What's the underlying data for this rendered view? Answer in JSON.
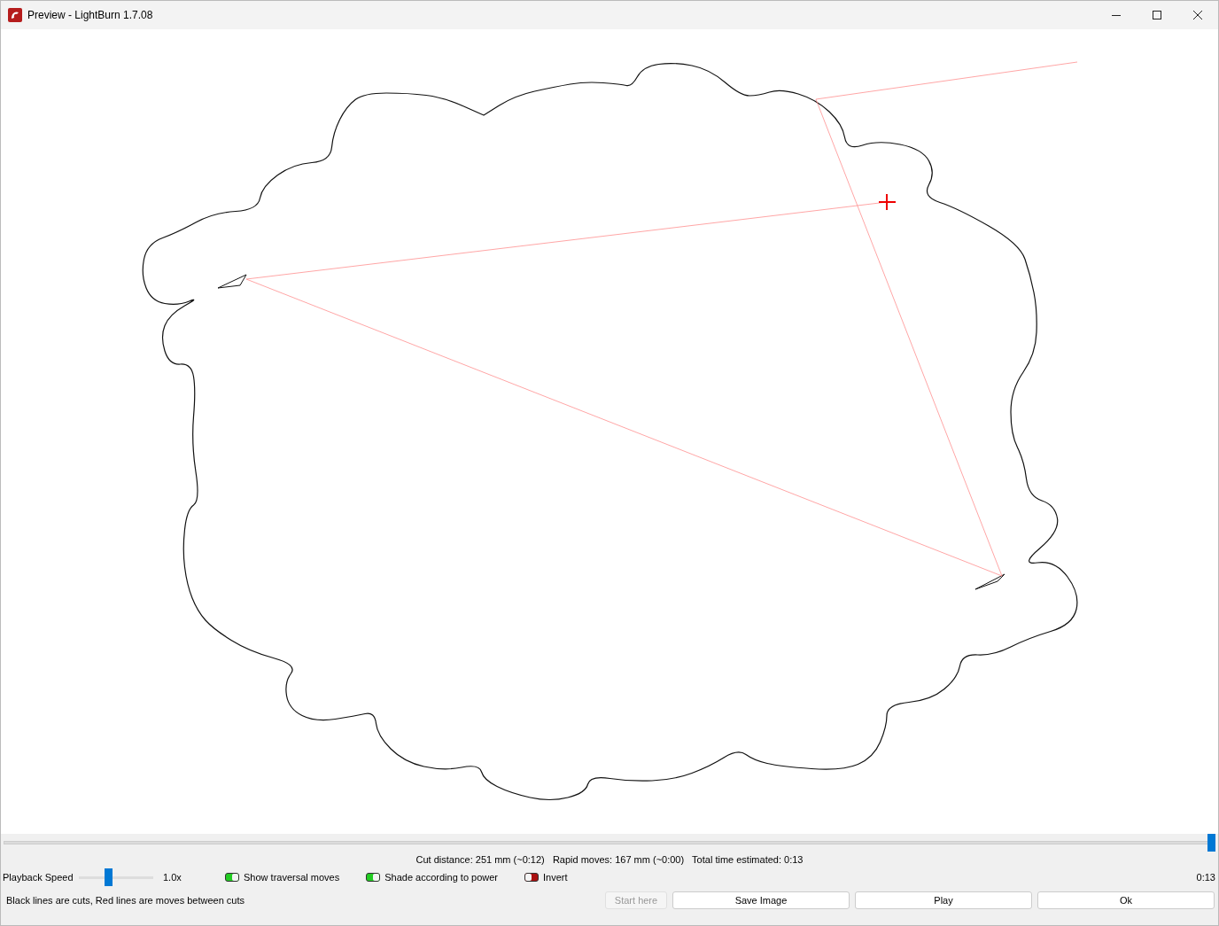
{
  "window": {
    "title": "Preview - LightBurn 1.7.08"
  },
  "timeline": {
    "level": 1.0
  },
  "stats": "Cut distance: 251 mm (~0:12)   Rapid moves: 167 mm (~0:00)   Total time estimated: 0:13",
  "playback_speed": {
    "label": "Playback Speed",
    "level": 0.38,
    "reading": "1.0x"
  },
  "toggles": [
    {
      "label": "Show traversal moves",
      "on": true
    },
    {
      "label": "Shade according to power",
      "on": true
    },
    {
      "label": "Invert",
      "on": false
    }
  ],
  "elapsed": "0:13",
  "legend": "Black lines are cuts, Red lines are moves between cuts",
  "buttons": [
    {
      "label": "Start here",
      "disabled": true
    },
    {
      "label": "Save Image",
      "disabled": false
    },
    {
      "label": "Play",
      "disabled": false
    },
    {
      "label": "Ok",
      "disabled": false
    }
  ]
}
